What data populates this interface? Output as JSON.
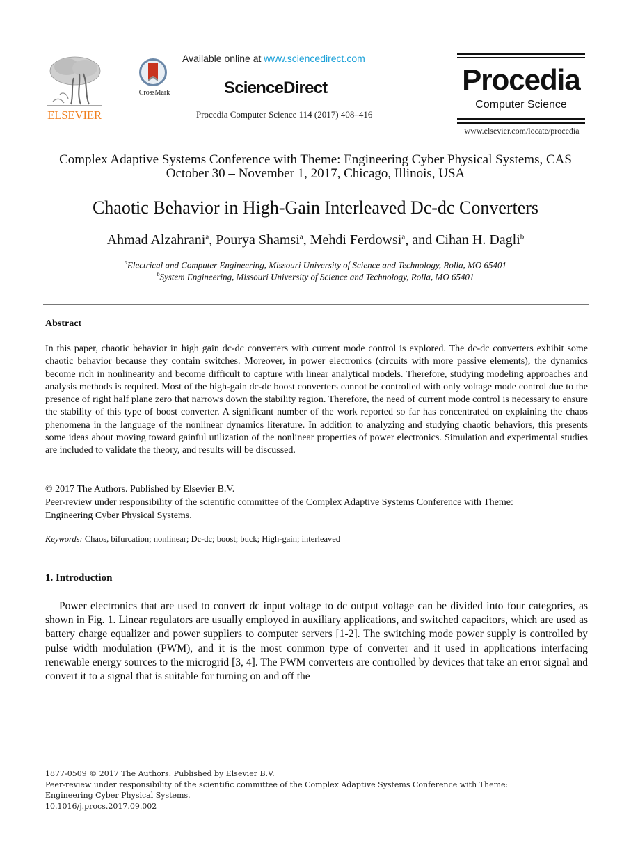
{
  "header": {
    "publisher_logo_text": "ELSEVIER",
    "crossmark_label": "CrossMark",
    "available_prefix": "Available online at ",
    "available_link": "www.sciencedirect.com",
    "platform_name": "ScienceDirect",
    "journal_reference": "Procedia Computer Science 114 (2017) 408–416",
    "journal_logo_title": "Procedia",
    "journal_logo_subtitle": "Computer Science",
    "journal_url": "www.elsevier.com/locate/procedia",
    "colors": {
      "elsevier_orange": "#f07f1e",
      "link_blue": "#1aa0d8",
      "crossmark_red": "#c8341f",
      "crossmark_ring": "#6b88a8"
    }
  },
  "conference": {
    "line1": "Complex Adaptive Systems Conference with Theme: Engineering Cyber Physical Systems, CAS",
    "line2": "October 30 – November 1, 2017, Chicago, Illinois, USA"
  },
  "paper": {
    "title": "Chaotic Behavior in High-Gain Interleaved Dc-dc Converters",
    "authors": [
      {
        "name": "Ahmad Alzahrani",
        "affil": "a",
        "sep": ", "
      },
      {
        "name": "Pourya Shamsi",
        "affil": "a",
        "sep": ", "
      },
      {
        "name": "Mehdi Ferdowsi",
        "affil": "a",
        "sep": ", and "
      },
      {
        "name": "Cihan H. Dagli",
        "affil": "b",
        "sep": ""
      }
    ],
    "affiliations": [
      {
        "mark": "a",
        "text": "Electrical and Computer Engineering, Missouri University of Science and Technology, Rolla, MO 65401"
      },
      {
        "mark": "b",
        "text": "System Engineering, Missouri University of Science and Technology, Rolla, MO 65401"
      }
    ]
  },
  "abstract": {
    "heading": "Abstract",
    "text": "In this paper, chaotic behavior in high gain dc-dc converters with current mode control is explored. The dc-dc converters exhibit some chaotic behavior because they contain switches. Moreover, in power electronics (circuits with more passive elements), the dynamics become rich in nonlinearity and become difficult to capture with linear analytical models. Therefore, studying modeling approaches and analysis methods is required. Most of the high-gain dc-dc boost converters cannot be controlled with only voltage mode control due to the presence of right half plane zero that narrows down the stability region. Therefore, the need of current mode control is necessary to ensure the stability of this type of boost converter. A significant number of the work reported so far has concentrated on explaining the chaos phenomena in the language of the nonlinear dynamics literature. In addition to analyzing and studying chaotic behaviors, this presents some ideas about moving toward gainful utilization of the nonlinear properties of power electronics. Simulation and experimental studies are included to validate the theory, and results will be discussed.",
    "copyright": "© 2017 The Authors. Published by Elsevier B.V.",
    "peer_review": "Peer-review under responsibility of the scientific committee of the Complex Adaptive Systems Conference with Theme: Engineering Cyber Physical Systems.",
    "keywords_label": "Keywords:",
    "keywords": " Chaos, bifurcation; nonlinear; Dc-dc; boost; buck; High-gain; interleaved"
  },
  "introduction": {
    "heading": "1. Introduction",
    "text": "Power electronics that are used to convert dc input voltage to dc output voltage can be divided into four categories, as shown in Fig. 1. Linear regulators are usually employed in auxiliary applications, and switched capacitors, which are used as battery charge equalizer and power suppliers to computer servers [1-2].  The switching mode power supply is controlled by pulse width modulation (PWM), and it is the most common type of converter and it used in applications interfacing renewable energy sources to the microgrid [3, 4].  The PWM converters are controlled by devices that take an error signal and convert it to a signal that is suitable for turning on and off the"
  },
  "footer": {
    "line1": "1877-0509 © 2017 The Authors. Published by Elsevier B.V.",
    "line2": "Peer-review under responsibility of the scientific committee of the Complex Adaptive Systems Conference with Theme:",
    "line3": "Engineering Cyber Physical Systems.",
    "doi": "10.1016/j.procs.2017.09.002"
  }
}
